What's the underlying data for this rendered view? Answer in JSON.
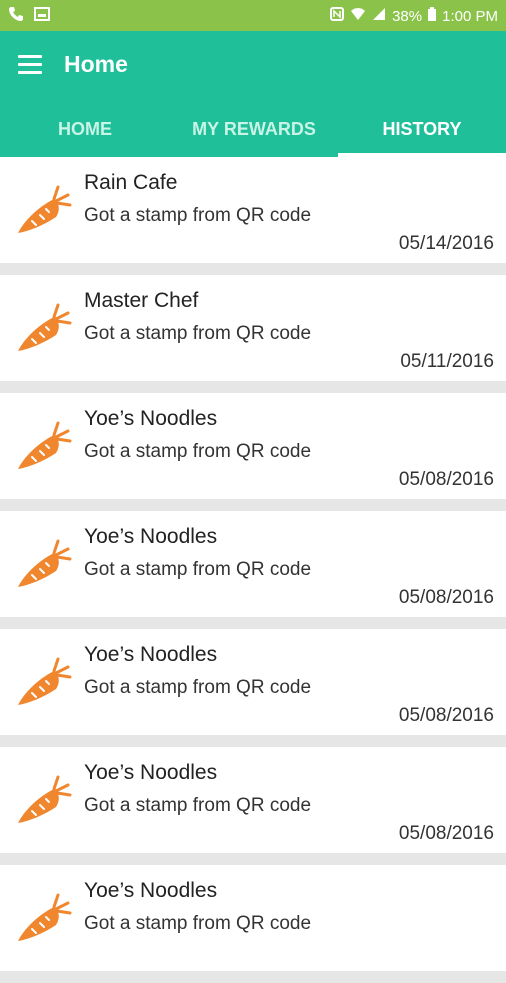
{
  "status_bar": {
    "battery": "38%",
    "time": "1:00 PM"
  },
  "app_bar": {
    "title": "Home"
  },
  "tabs": [
    {
      "label": "HOME"
    },
    {
      "label": "MY REWARDS"
    },
    {
      "label": "HISTORY"
    }
  ],
  "history": [
    {
      "name": "Rain Cafe",
      "desc": "Got a stamp from QR code",
      "date": "05/14/2016"
    },
    {
      "name": "Master Chef",
      "desc": "Got a stamp from QR code",
      "date": "05/11/2016"
    },
    {
      "name": "Yoe’s Noodles",
      "desc": "Got a stamp from QR code",
      "date": "05/08/2016"
    },
    {
      "name": "Yoe’s Noodles",
      "desc": "Got a stamp from QR code",
      "date": "05/08/2016"
    },
    {
      "name": "Yoe’s Noodles",
      "desc": "Got a stamp from QR code",
      "date": "05/08/2016"
    },
    {
      "name": "Yoe’s Noodles",
      "desc": "Got a stamp from QR code",
      "date": "05/08/2016"
    },
    {
      "name": "Yoe’s Noodles",
      "desc": "Got a stamp from QR code",
      "date": ""
    }
  ],
  "icons": {
    "item_icon": "carrot-icon",
    "menu": "hamburger-menu-icon"
  },
  "colors": {
    "status_bar": "#8bc34a",
    "app_bar": "#1fbf9a",
    "carrot": "#f0862e"
  }
}
